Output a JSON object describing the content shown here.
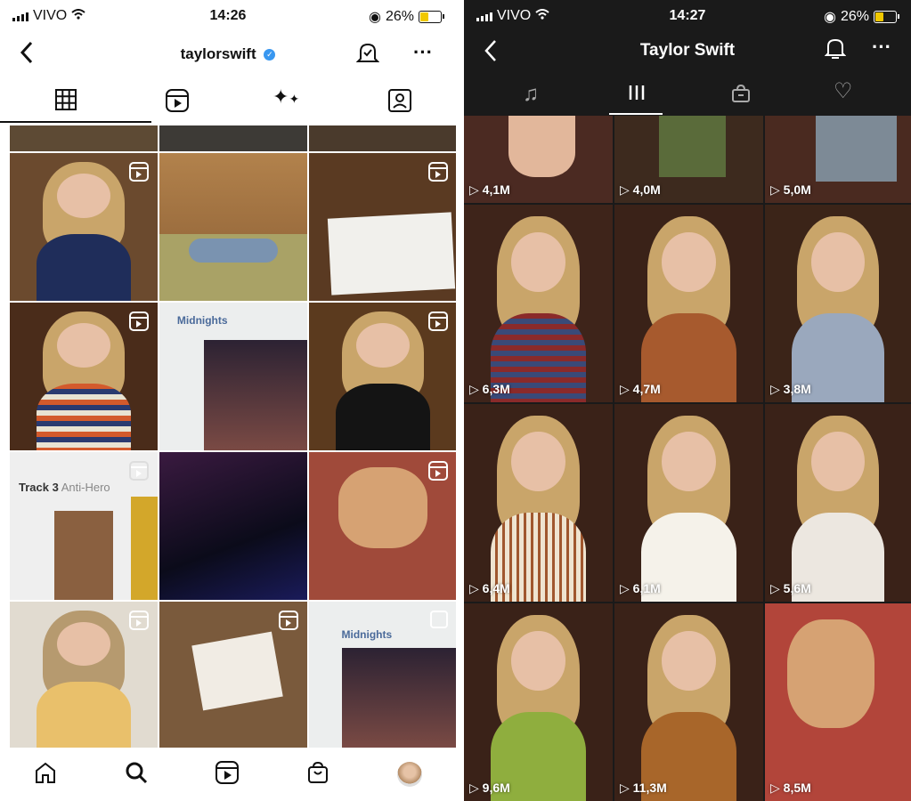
{
  "ig": {
    "status": {
      "carrier": "VIVO",
      "time": "14:26",
      "battery": "26%"
    },
    "header": {
      "username": "taylorswift"
    },
    "tabs": [
      {
        "name": "grid",
        "active": true
      },
      {
        "name": "reels",
        "active": false
      },
      {
        "name": "guides",
        "active": false
      },
      {
        "name": "tagged",
        "active": false
      }
    ],
    "album_texts": {
      "midnights_1": "Midnights",
      "track3": "Track 3",
      "track3_sub": "Anti-Hero",
      "midnights_2": "Midnights"
    },
    "bottom_nav": [
      "home",
      "search",
      "reels",
      "shop",
      "profile"
    ]
  },
  "tt": {
    "status": {
      "carrier": "VIVO",
      "time": "14:27",
      "battery": "26%"
    },
    "header": {
      "title": "Taylor Swift"
    },
    "tabs": [
      {
        "name": "music",
        "active": false
      },
      {
        "name": "videos",
        "active": true
      },
      {
        "name": "shop",
        "active": false
      },
      {
        "name": "liked",
        "active": false
      }
    ],
    "videos": [
      {
        "views": "4,1M"
      },
      {
        "views": "4,0M"
      },
      {
        "views": "5,0M"
      },
      {
        "views": "6,3M"
      },
      {
        "views": "4,7M"
      },
      {
        "views": "3,8M"
      },
      {
        "views": "6,4M"
      },
      {
        "views": "6,1M"
      },
      {
        "views": "5,6M"
      },
      {
        "views": "9,6M"
      },
      {
        "views": "11,3M"
      },
      {
        "views": "8,5M"
      }
    ]
  }
}
